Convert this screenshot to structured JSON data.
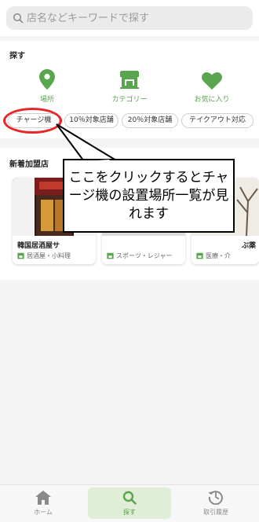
{
  "search": {
    "placeholder": "店名などキーワードで探す"
  },
  "explore": {
    "title": "探す",
    "categories": [
      {
        "label": "場所",
        "icon": "map-pin-icon"
      },
      {
        "label": "カテゴリー",
        "icon": "store-icon"
      },
      {
        "label": "お気に入り",
        "icon": "heart-icon"
      }
    ],
    "chips": [
      "チャージ機",
      "10％対象店舗",
      "20％対象店舗",
      "テイクアウト対応"
    ]
  },
  "new_shops": {
    "title": "新着加盟店",
    "cards": [
      {
        "name": "韓国居酒屋サ",
        "genre": "居酒屋・小料理"
      },
      {
        "name": "",
        "genre": "スポーツ・レジャー"
      },
      {
        "name": "ぷ薬",
        "genre": "医療・介"
      }
    ]
  },
  "callout": {
    "text": "ここをクリックするとチャージ機の設置場所一覧が見れます"
  },
  "nav": [
    {
      "label": "ホーム",
      "icon": "home-icon",
      "active": false
    },
    {
      "label": "探す",
      "icon": "search-icon",
      "active": true
    },
    {
      "label": "取引履歴",
      "icon": "history-icon",
      "active": false
    }
  ],
  "colors": {
    "accent": "#5aa64f",
    "highlight": "#e8262a",
    "nav_active_bg": "#e1eed7"
  }
}
